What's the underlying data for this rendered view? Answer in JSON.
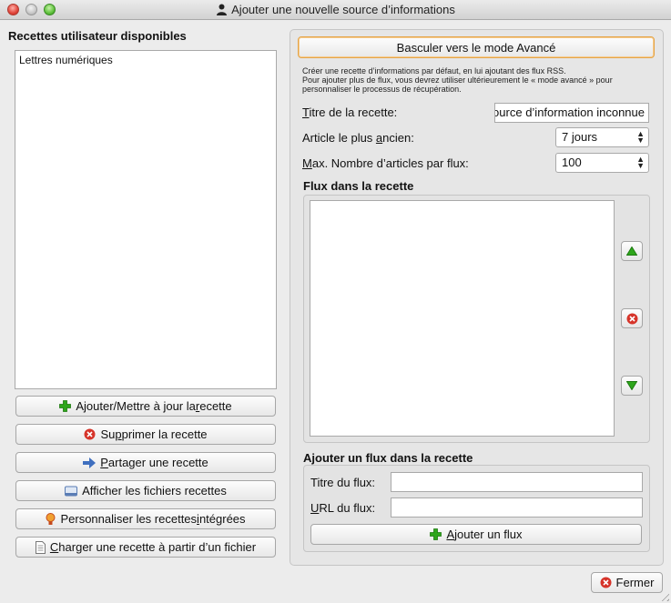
{
  "window": {
    "title": "Ajouter une nouvelle source d’informations"
  },
  "left": {
    "header": "Recettes utilisateur disponibles",
    "recipes": [
      "Lettres numériques"
    ],
    "buttons": {
      "add_update": {
        "pre": "Ajouter/Mettre à jour la ",
        "ul": "r",
        "post": "ecette"
      },
      "delete": {
        "pre": "Su",
        "ul": "p",
        "post": "primer la recette"
      },
      "share": {
        "pre": "",
        "ul": "P",
        "post": "artager une recette"
      },
      "show_files": {
        "pre": "Afficher les fichiers recettes",
        "ul": "",
        "post": ""
      },
      "customize": {
        "pre": "Personnaliser les recettes ",
        "ul": "i",
        "post": "ntégrées"
      },
      "load": {
        "pre": "",
        "ul": "C",
        "post": "harger une recette à partir d’un fichier"
      }
    }
  },
  "right": {
    "mode_button": "Basculer vers le mode Avancé",
    "description": "Créer une recette d’informations par défaut, en lui ajoutant des flux RSS.\nPour ajouter plus de flux, vous devrez utiliser ultérieurement le « mode avancé » pour personnaliser le processus de récupération.",
    "recipe_title": {
      "pre": "",
      "ul": "T",
      "post": "itre de la recette:",
      "value": "Source d’information inconnue"
    },
    "oldest_article": {
      "pre": "Article le plus ",
      "ul": "a",
      "post": "ncien:",
      "value": "7 jours"
    },
    "max_articles": {
      "pre": "",
      "ul": "M",
      "post": "ax. Nombre d’articles par flux:",
      "value": "100"
    },
    "feeds_section": "Flux dans la recette",
    "feeds": [],
    "add_feed": {
      "section": "Ajouter un flux dans la recette",
      "feed_title_label": "Titre du flux:",
      "feed_title_value": "",
      "url_label": {
        "pre": "",
        "ul": "U",
        "post": "RL du flux:"
      },
      "url_value": "",
      "button": {
        "pre": "",
        "ul": "A",
        "post": "jouter un flux"
      }
    }
  },
  "footer": {
    "close": "Fermer"
  },
  "colors": {
    "green_add": "#2ea61c",
    "red_delete": "#d6342a",
    "focus_ring": "#e5a447"
  }
}
